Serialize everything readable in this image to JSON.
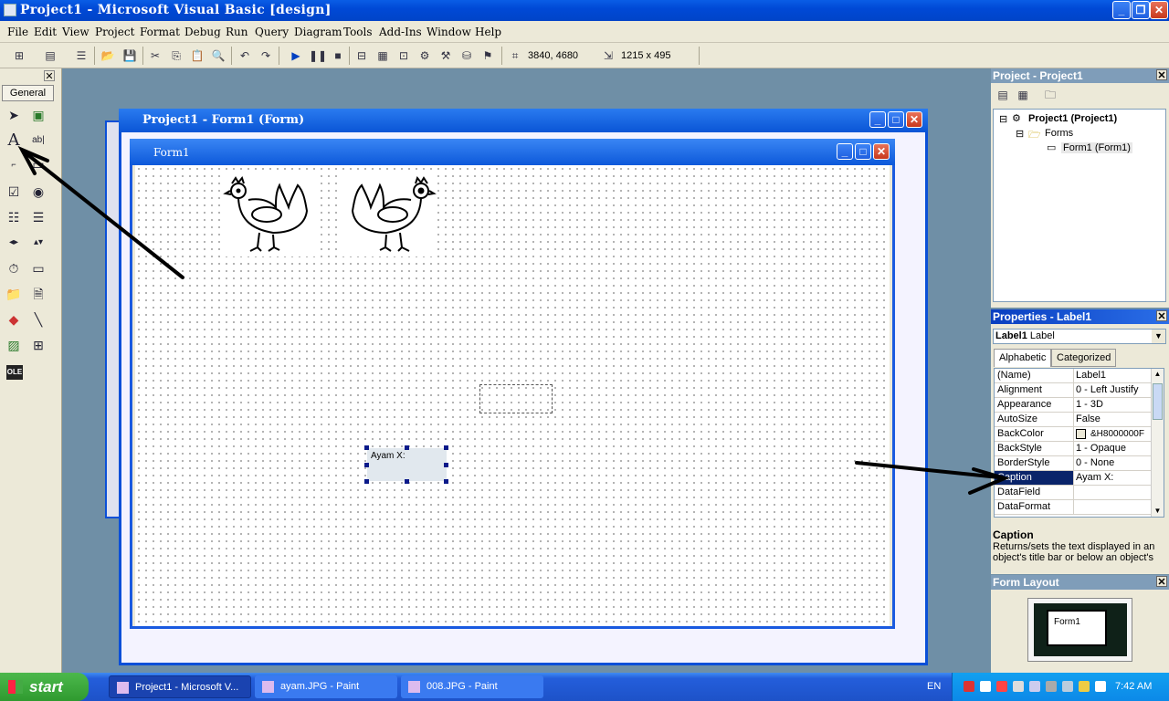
{
  "window": {
    "title": "Project1 - Microsoft Visual Basic [design]"
  },
  "menu": [
    "File",
    "Edit",
    "View",
    "Project",
    "Format",
    "Debug",
    "Run",
    "Query",
    "Diagram",
    "Tools",
    "Add-Ins",
    "Window",
    "Help"
  ],
  "toolbar": {
    "position": "3840, 4680",
    "size": "1215 x 495"
  },
  "toolbox": {
    "tab_label": "General"
  },
  "project_window": {
    "title": "Project1 - Form1 (Form)"
  },
  "form_window": {
    "title": "Form1"
  },
  "form": {
    "label_caption": "Ayam X:"
  },
  "project_explorer": {
    "title": "Project - Project1",
    "root": "Project1 (Project1)",
    "folder": "Forms",
    "item": "Form1 (Form1)"
  },
  "properties": {
    "title": "Properties - Label1",
    "object_name": "Label1",
    "object_type": "Label",
    "tabs": [
      "Alphabetic",
      "Categorized"
    ],
    "rows": [
      {
        "name": "(Name)",
        "value": "Label1"
      },
      {
        "name": "Alignment",
        "value": "0 - Left Justify"
      },
      {
        "name": "Appearance",
        "value": "1 - 3D"
      },
      {
        "name": "AutoSize",
        "value": "False"
      },
      {
        "name": "BackColor",
        "value": "&H8000000F"
      },
      {
        "name": "BackStyle",
        "value": "1 - Opaque"
      },
      {
        "name": "BorderStyle",
        "value": "0 - None"
      },
      {
        "name": "Caption",
        "value": "Ayam X:"
      },
      {
        "name": "DataField",
        "value": ""
      },
      {
        "name": "DataFormat",
        "value": ""
      }
    ],
    "desc_title": "Caption",
    "desc_text": "Returns/sets the text displayed in an object's title bar or below an object's"
  },
  "form_layout": {
    "title": "Form Layout",
    "form_label": "Form1"
  },
  "taskbar": {
    "start": "start",
    "tasks": [
      "Project1 - Microsoft V...",
      "ayam.JPG - Paint",
      "008.JPG - Paint"
    ],
    "lang": "EN",
    "clock": "7:42 AM"
  },
  "colors": {
    "titlebar": "#0a5de6",
    "selection": "#0a246a",
    "taskbar": "#245edb",
    "start": "#2f9a2f"
  }
}
